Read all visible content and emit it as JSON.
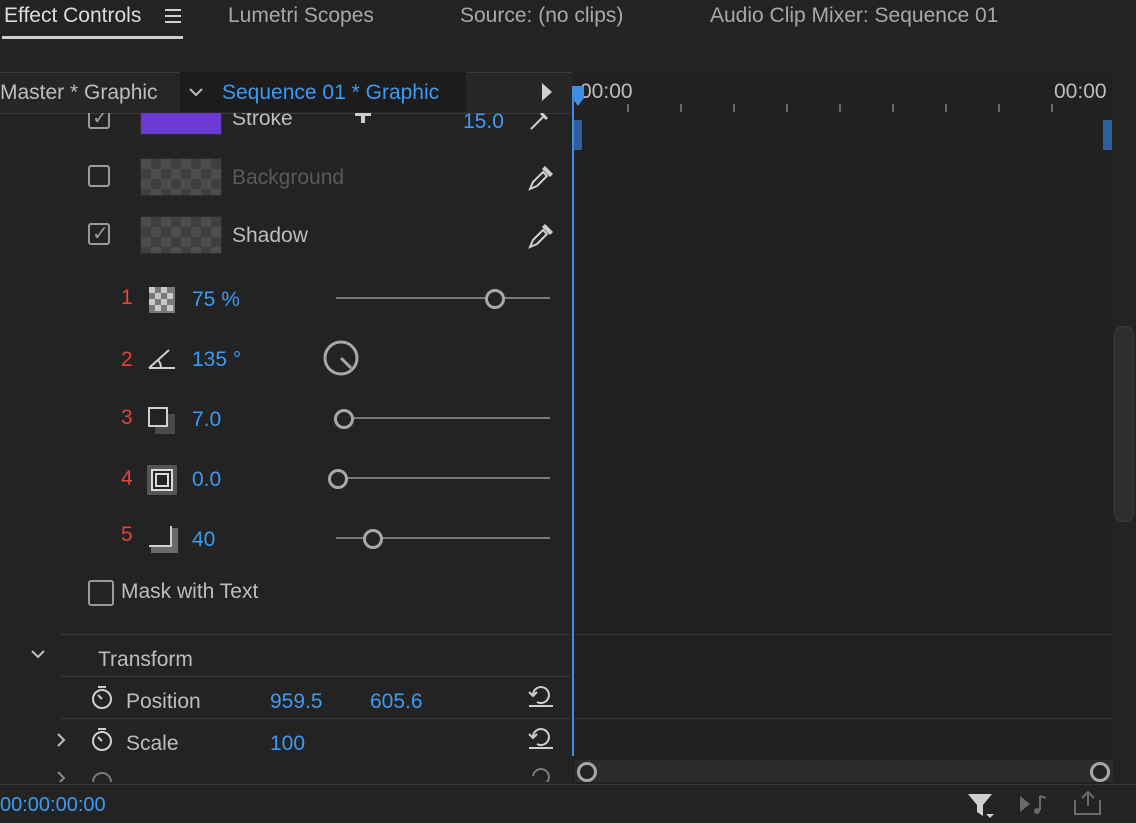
{
  "tabs": [
    {
      "label": "Effect Controls",
      "active": true
    },
    {
      "label": "Lumetri Scopes"
    },
    {
      "label": "Source: (no clips)"
    },
    {
      "label": "Audio Clip Mixer: Sequence 01"
    }
  ],
  "header": {
    "master_clip": "Master * Graphic",
    "sequence_clip": "Sequence 01 * Graphic"
  },
  "timeline": {
    "start_time": "00:00",
    "end_time": "00:00",
    "scroll_start_fraction": 0.0,
    "scroll_end_fraction": 1.0
  },
  "appearance": {
    "stroke": {
      "label": "Stroke",
      "checked": true,
      "color": "#6a3ad2",
      "value": "15.0"
    },
    "background": {
      "label": "Background",
      "checked": false
    },
    "shadow": {
      "label": "Shadow",
      "checked": true
    }
  },
  "shadow_props": [
    {
      "num": "1",
      "icon": "checkerboard-opacity-icon",
      "value": "75 %",
      "slider_fraction": 0.78
    },
    {
      "num": "2",
      "icon": "angle-icon",
      "value": "135 °"
    },
    {
      "num": "3",
      "icon": "shadow-distance-icon",
      "value": "7.0",
      "slider_fraction": 0.0
    },
    {
      "num": "4",
      "icon": "shadow-size-icon",
      "value": "0.0",
      "slider_fraction": 0.0
    },
    {
      "num": "5",
      "icon": "shadow-blur-icon",
      "value": "40",
      "slider_fraction": 0.15
    }
  ],
  "mask": {
    "label": "Mask with Text",
    "checked": false
  },
  "transform": {
    "label": "Transform",
    "position": {
      "label": "Position",
      "x": "959.5",
      "y": "605.6"
    },
    "scale": {
      "label": "Scale",
      "value": "100"
    }
  },
  "timecode": "00:00:00:00",
  "colors": {
    "accent": "#3d9af3",
    "index_red": "#e0443a",
    "playhead": "#3d8de0"
  }
}
